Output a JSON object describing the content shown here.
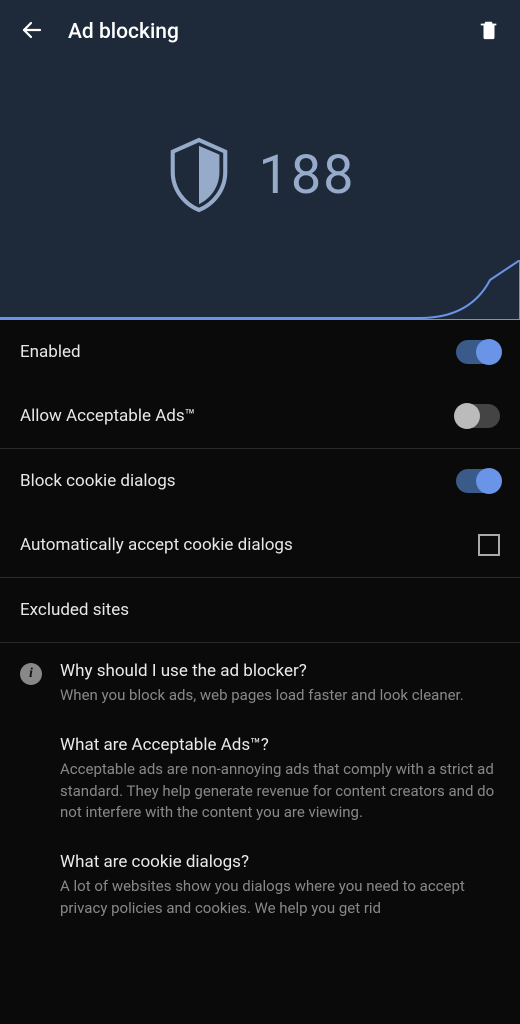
{
  "header": {
    "title": "Ad blocking",
    "count": "188"
  },
  "settings": {
    "enabled_label": "Enabled",
    "enabled_on": true,
    "acceptable_label": "Allow Acceptable Ads™",
    "acceptable_on": false,
    "block_cookie_label": "Block cookie dialogs",
    "block_cookie_on": true,
    "auto_accept_label": "Automatically accept cookie dialogs",
    "auto_accept_checked": false,
    "excluded_label": "Excluded sites"
  },
  "info": [
    {
      "q": "Why should I use the ad blocker?",
      "a": "When you block ads, web pages load faster and look cleaner."
    },
    {
      "q": "What are Acceptable Ads™?",
      "a": "Acceptable ads are non-annoying ads that comply with a strict ad standard. They help generate revenue for content creators and do not interfere with the content you are viewing."
    },
    {
      "q": "What are cookie dialogs?",
      "a": "A lot of websites show you dialogs where you need to accept privacy policies and cookies. We help you get rid"
    }
  ]
}
